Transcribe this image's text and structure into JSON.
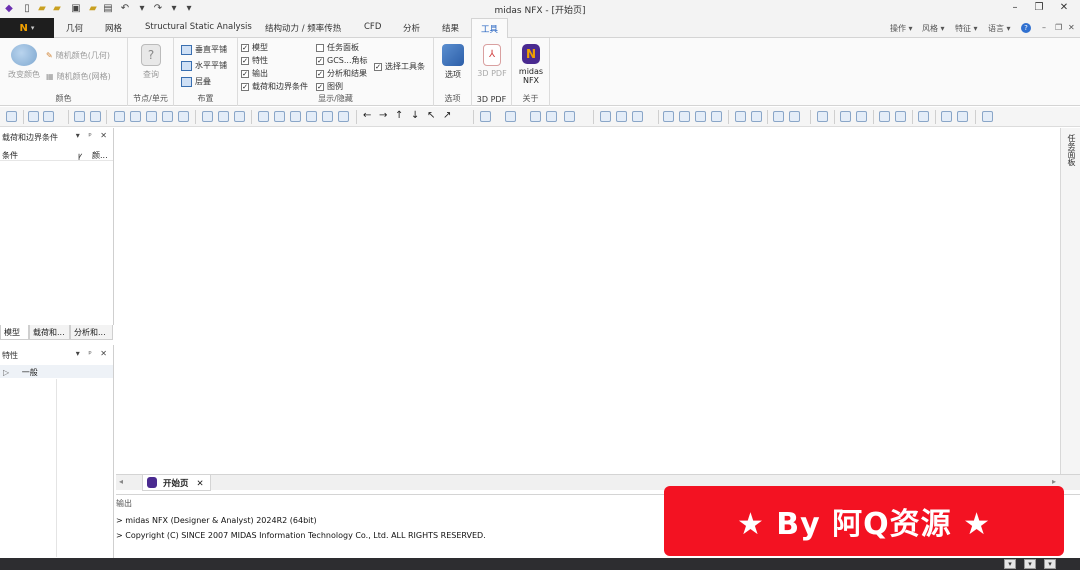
{
  "window": {
    "title": "midas NFX - [开始页]",
    "controls": [
      "–",
      "❐",
      "✕"
    ]
  },
  "app_button": "N",
  "tabs": [
    {
      "label": "几何"
    },
    {
      "label": "网格"
    },
    {
      "label": "Structural Static Analysis"
    },
    {
      "label": "结构动力 / 频率传热"
    },
    {
      "label": "CFD"
    },
    {
      "label": "分析"
    },
    {
      "label": "结果"
    },
    {
      "label": "工具"
    }
  ],
  "top_right": {
    "a": "操作",
    "b": "风格",
    "c": "特征",
    "d": "语言",
    "help": "?"
  },
  "ribbon": {
    "color_group": {
      "label": "颜色",
      "change_color": "改变颜色",
      "random_geo": "随机颜色(几何)",
      "random_mesh": "随机颜色(网格)"
    },
    "node_group": {
      "label": "节点/单元",
      "query": "查询"
    },
    "layout_group": {
      "label": "布置",
      "vertical": "垂直平铺",
      "horizontal": "水平平铺",
      "cascade": "层叠"
    },
    "display_group": {
      "label": "显示/隐藏",
      "model": "模型",
      "property": "特性",
      "output": "输出",
      "load_bc": "载荷和边界条件",
      "task_panel": "任务面板",
      "gcs": "GCS...角标",
      "analysis_results": "分析和结果",
      "legend": "图例",
      "selection_toolbar": "选择工具条"
    },
    "options_group": {
      "label": "选项",
      "options": "选项"
    },
    "pdf_group": {
      "label": "3D PDF",
      "pdf": "3D PDF"
    },
    "about_group": {
      "label": "关于",
      "midas": "midas NFX"
    }
  },
  "left_panel_top": {
    "title": "载荷和边界条件",
    "col_condition": "条件",
    "col_color": "颜..."
  },
  "left_tabs": [
    {
      "label": "模型"
    },
    {
      "label": "载荷和..."
    },
    {
      "label": "分析和..."
    }
  ],
  "left_panel_props": {
    "title": "特性",
    "row": "一般"
  },
  "right_side": {
    "label": "任务面板"
  },
  "doc_tab": {
    "label": "开始页",
    "close": "✕"
  },
  "output": {
    "title": "输出",
    "lines": [
      "> midas NFX (Designer & Analyst) 2024R2 (64bit)",
      "> Copyright (C) SINCE 2007 MIDAS Information Technology Co., Ltd. ALL RIGHTS RESERVED."
    ]
  },
  "watermark": "★ By 阿Q资源 ★",
  "colors": {
    "watermark_bg": "#f31222",
    "app_button_bg": "#1e1e1e",
    "accent": "#2060c0"
  }
}
